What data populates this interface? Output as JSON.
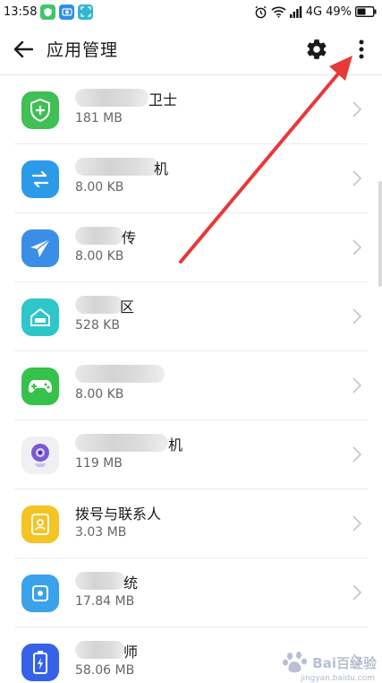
{
  "status_bar": {
    "time": "13:58",
    "network": "4G",
    "battery": "49%"
  },
  "header": {
    "title": "应用管理"
  },
  "apps": [
    {
      "name": "卫士",
      "size": "181 MB",
      "icon": "shield-plus-icon",
      "color": "#3fbf54"
    },
    {
      "name": "机",
      "size": "8.00 KB",
      "icon": "transfer-arrows-icon",
      "color": "#2b9ae8"
    },
    {
      "name": "传",
      "size": "8.00 KB",
      "icon": "paper-plane-icon",
      "color": "#3a8ee8"
    },
    {
      "name": "区",
      "size": "528 KB",
      "icon": "home-360-icon",
      "color": "#2ec6c9"
    },
    {
      "name": "",
      "size": "8.00 KB",
      "icon": "gamepad-icon",
      "color": "#36c24a"
    },
    {
      "name": "机",
      "size": "119 MB",
      "icon": "camera-bot-icon",
      "color": "#f0f0f4"
    },
    {
      "name": "拨号与联系人",
      "size": "3.03 MB",
      "icon": "contact-person-icon",
      "color": "#f5c323"
    },
    {
      "name": "统",
      "size": "17.84 MB",
      "icon": "system-chip-icon",
      "color": "#3aa2ea"
    },
    {
      "name": "师",
      "size": "58.06 MB",
      "icon": "battery-icon",
      "color": "#3562e6"
    }
  ],
  "watermark": {
    "text": "Bai百经验",
    "sub": "jingyan.baidu.com"
  }
}
